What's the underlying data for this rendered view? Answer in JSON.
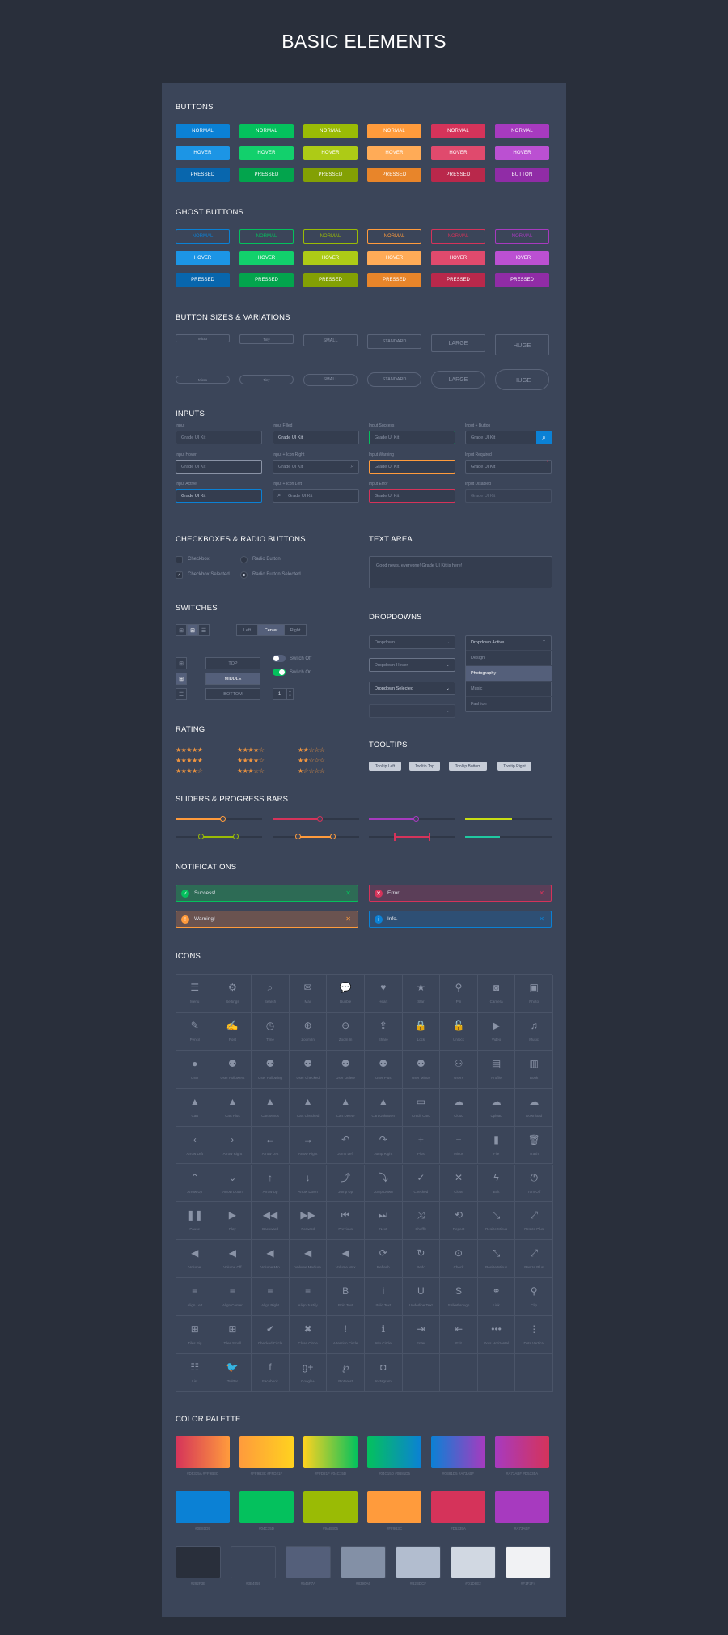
{
  "title": "BASIC ELEMENTS",
  "sections": {
    "buttons": "BUTTONS",
    "ghost": "GHOST BUTTONS",
    "sizes": "BUTTON SIZES & VARIATIONS",
    "inputs": "INPUTS",
    "checkboxes": "CHECKBOXES & RADIO BUTTONS",
    "textarea": "TEXT AREA",
    "switches": "SWITCHES",
    "dropdowns": "DROPDOWNS",
    "rating": "RATING",
    "tooltips": "TOOLTIPS",
    "sliders": "SLIDERS & PROGRESS BARS",
    "notifications": "NOTIFICATIONS",
    "icons": "ICONS",
    "palette": "COLOR PALETTE"
  },
  "colors": [
    "#0b81d5",
    "#04c15d",
    "#9abb05",
    "#ff9b3c",
    "#d5335a",
    "#a73abf"
  ],
  "hover_colors": [
    "#1c95e5",
    "#12d06c",
    "#adcb16",
    "#ffab57",
    "#e04a6d",
    "#bb50d2"
  ],
  "pressed_colors": [
    "#0866ad",
    "#03a44d",
    "#83a004",
    "#e8852a",
    "#b9284b",
    "#902ca6"
  ],
  "buttons": {
    "rows": [
      [
        "NORMAL",
        "NORMAL",
        "NORMAL",
        "NORMAL",
        "NORMAL",
        "NORMAL"
      ],
      [
        "HOVER",
        "HOVER",
        "HOVER",
        "HOVER",
        "HOVER",
        "HOVER"
      ],
      [
        "PRESSED",
        "PRESSED",
        "PRESSED",
        "PRESSED",
        "PRESSED",
        "BUTTON"
      ]
    ]
  },
  "ghost_buttons": {
    "rows": [
      [
        "NORMAL",
        "NORMAL",
        "NORMAL",
        "NORMAL",
        "NORMAL",
        "NORMAL"
      ],
      [
        "HOVER",
        "HOVER",
        "HOVER",
        "HOVER",
        "HOVER",
        "HOVER"
      ],
      [
        "PRESSED",
        "PRESSED",
        "PRESSED",
        "PRESSED",
        "PRESSED",
        "PRESSED"
      ]
    ]
  },
  "sizes": [
    "Micro",
    "Tiny",
    "SMALL",
    "STANDARD",
    "LARGE",
    "HUGE"
  ],
  "inputs": [
    {
      "label": "Input",
      "value": "Grade UI Kit"
    },
    {
      "label": "Input Filled",
      "value": "Grade UI Kit"
    },
    {
      "label": "Input Success",
      "value": "Grade UI Kit"
    },
    {
      "label": "Input + Button",
      "value": "Grade UI Kit"
    },
    {
      "label": "Input Hover",
      "value": "Grade UI Kit"
    },
    {
      "label": "Input + Icon Right",
      "value": "Grade UI Kit"
    },
    {
      "label": "Input Warning",
      "value": "Grade UI Kit"
    },
    {
      "label": "Input Required",
      "value": "Grade UI Kit"
    },
    {
      "label": "Input Active",
      "value": "Grade UI Kit"
    },
    {
      "label": "Input + Icon Left",
      "value": "Grade UI Kit"
    },
    {
      "label": "Input Error",
      "value": "Grade UI Kit"
    },
    {
      "label": "Input Disabled",
      "value": "Grade UI Kit"
    }
  ],
  "checkboxes": {
    "cb1": "Checkbox",
    "cb2": "Checkbox Selected",
    "rb1": "Radio Button",
    "rb2": "Radio Button Selected"
  },
  "textarea": {
    "value": "Good news, everyone! Grade UI Kit is here!"
  },
  "switches": {
    "segments": [
      "Left",
      "Center",
      "Right"
    ],
    "vertical": [
      "TOP",
      "MIDDLE",
      "BOTTOM"
    ],
    "switch_off": "Switch Off",
    "switch_on": "Switch On",
    "stepper": "1"
  },
  "dropdowns": {
    "d1": "Dropdown",
    "d2": "Dropdown Hover",
    "d3": "Dropdown Selected",
    "active": "Dropdown Active",
    "options": [
      "Design",
      "Photography",
      "Music",
      "Fashion"
    ]
  },
  "ratings": [
    [
      "★★★★★",
      "★★★★☆",
      "★★☆☆☆"
    ],
    [
      "★★★★★",
      "★★★★☆",
      "★★☆☆☆"
    ],
    [
      "★★★★☆",
      "★★★☆☆",
      "★☆☆☆☆"
    ]
  ],
  "tooltips": [
    "Tooltip Left",
    "Tooltip Top",
    "Tooltip Bottom",
    "Tooltip Right"
  ],
  "sliders": [
    {
      "fraction": 0.8,
      "color": "#ff9b3c"
    },
    {
      "fraction": 0.8,
      "color": "#d5335a"
    },
    {
      "fraction": 0.8,
      "color": "#a73abf"
    },
    {
      "fraction": 0.8,
      "color": "#c8de14"
    },
    {
      "range": [
        0.4,
        1.2
      ],
      "color": "#9abb05"
    },
    {
      "range": [
        0.4,
        1.2
      ],
      "color": "#ff9b3c"
    },
    {
      "range": [
        0.4,
        1.2
      ],
      "color": "#d5335a"
    },
    {
      "range": [
        0,
        0.8
      ],
      "color": "#1fc9a1"
    }
  ],
  "notifications": [
    {
      "text": "Success!",
      "type": "success"
    },
    {
      "text": "Error!",
      "type": "error"
    },
    {
      "text": "Warning!",
      "type": "warning"
    },
    {
      "text": "Info.",
      "type": "info"
    }
  ],
  "icons": [
    {
      "g": "☰",
      "l": "Menu",
      "n": "menu-icon"
    },
    {
      "g": "⚙",
      "l": "Settings",
      "n": "settings-icon"
    },
    {
      "g": "⌕",
      "l": "Search",
      "n": "search-icon"
    },
    {
      "g": "✉",
      "l": "Mail",
      "n": "mail-icon"
    },
    {
      "g": "💬",
      "l": "Bubble",
      "n": "bubble-icon"
    },
    {
      "g": "♥",
      "l": "Heart",
      "n": "heart-icon"
    },
    {
      "g": "★",
      "l": "Star",
      "n": "star-icon"
    },
    {
      "g": "⚲",
      "l": "Pin",
      "n": "pin-icon"
    },
    {
      "g": "◙",
      "l": "Camera",
      "n": "camera-icon"
    },
    {
      "g": "▣",
      "l": "Photo",
      "n": "photo-icon"
    },
    {
      "g": "✎",
      "l": "Pencil",
      "n": "pencil-icon"
    },
    {
      "g": "✍",
      "l": "Post",
      "n": "post-icon"
    },
    {
      "g": "◷",
      "l": "Time",
      "n": "time-icon"
    },
    {
      "g": "⊕",
      "l": "Zoom In",
      "n": "zoom-in-icon"
    },
    {
      "g": "⊖",
      "l": "Zoom In",
      "n": "zoom-out-icon"
    },
    {
      "g": "⇪",
      "l": "Share",
      "n": "share-icon"
    },
    {
      "g": "🔒",
      "l": "Lock",
      "n": "lock-icon"
    },
    {
      "g": "🔓",
      "l": "Unlock",
      "n": "unlock-icon"
    },
    {
      "g": "▶",
      "l": "Video",
      "n": "video-icon"
    },
    {
      "g": "♫",
      "l": "Music",
      "n": "music-icon"
    },
    {
      "g": "●",
      "l": "User",
      "n": "user-icon"
    },
    {
      "g": "⚉",
      "l": "User Followers",
      "n": "user-followers-icon"
    },
    {
      "g": "⚉",
      "l": "User Following",
      "n": "user-following-icon"
    },
    {
      "g": "⚉",
      "l": "User Checked",
      "n": "user-checked-icon"
    },
    {
      "g": "⚉",
      "l": "User Delete",
      "n": "user-delete-icon"
    },
    {
      "g": "⚉",
      "l": "User Plus",
      "n": "user-plus-icon"
    },
    {
      "g": "⚉",
      "l": "User Minus",
      "n": "user-minus-icon"
    },
    {
      "g": "⚇",
      "l": "Users",
      "n": "users-icon"
    },
    {
      "g": "▤",
      "l": "Profile",
      "n": "profile-icon"
    },
    {
      "g": "▥",
      "l": "Book",
      "n": "book-icon"
    },
    {
      "g": "▲",
      "l": "Cart",
      "n": "cart-icon"
    },
    {
      "g": "▲",
      "l": "Cart Plus",
      "n": "cart-plus-icon"
    },
    {
      "g": "▲",
      "l": "Cart Minus",
      "n": "cart-minus-icon"
    },
    {
      "g": "▲",
      "l": "Cart Checked",
      "n": "cart-checked-icon"
    },
    {
      "g": "▲",
      "l": "Cart Delete",
      "n": "cart-delete-icon"
    },
    {
      "g": "▲",
      "l": "Cart Unknown",
      "n": "cart-unknown-icon"
    },
    {
      "g": "▭",
      "l": "Credit Card",
      "n": "credit-card-icon"
    },
    {
      "g": "☁",
      "l": "Cloud",
      "n": "cloud-icon"
    },
    {
      "g": "☁",
      "l": "Upload",
      "n": "upload-icon"
    },
    {
      "g": "☁",
      "l": "Download",
      "n": "download-icon"
    },
    {
      "g": "‹",
      "l": "Arrow Left",
      "n": "arrow-left-icon"
    },
    {
      "g": "›",
      "l": "Arrow Right",
      "n": "arrow-right-icon"
    },
    {
      "g": "←",
      "l": "Arrow Left",
      "n": "long-arrow-left-icon"
    },
    {
      "g": "→",
      "l": "Arrow Right",
      "n": "long-arrow-right-icon"
    },
    {
      "g": "↶",
      "l": "Jump Left",
      "n": "jump-left-icon"
    },
    {
      "g": "↷",
      "l": "Jump Right",
      "n": "jump-right-icon"
    },
    {
      "g": "+",
      "l": "Plus",
      "n": "plus-icon"
    },
    {
      "g": "−",
      "l": "Minus",
      "n": "minus-icon"
    },
    {
      "g": "▮",
      "l": "File",
      "n": "file-icon"
    },
    {
      "g": "🗑",
      "l": "Trash",
      "n": "trash-icon"
    },
    {
      "g": "⌃",
      "l": "Arrow Up",
      "n": "arrow-up-icon"
    },
    {
      "g": "⌄",
      "l": "Arrow Down",
      "n": "arrow-down-icon"
    },
    {
      "g": "↑",
      "l": "Arrow Up",
      "n": "long-arrow-up-icon"
    },
    {
      "g": "↓",
      "l": "Arrow Down",
      "n": "long-arrow-down-icon"
    },
    {
      "g": "⤴",
      "l": "Jump Up",
      "n": "jump-up-icon"
    },
    {
      "g": "⤵",
      "l": "Jump Down",
      "n": "jump-down-icon"
    },
    {
      "g": "✓",
      "l": "Checked",
      "n": "checked-icon"
    },
    {
      "g": "✕",
      "l": "Close",
      "n": "close-icon"
    },
    {
      "g": "ϟ",
      "l": "Bolt",
      "n": "bolt-icon"
    },
    {
      "g": "⏻",
      "l": "Turn Off",
      "n": "turn-off-icon"
    },
    {
      "g": "❚❚",
      "l": "Pause",
      "n": "pause-icon"
    },
    {
      "g": "▶",
      "l": "Play",
      "n": "play-icon"
    },
    {
      "g": "◀◀",
      "l": "Backward",
      "n": "backward-icon"
    },
    {
      "g": "▶▶",
      "l": "Forward",
      "n": "forward-icon"
    },
    {
      "g": "⏮",
      "l": "Previous",
      "n": "previous-icon"
    },
    {
      "g": "⏭",
      "l": "Next",
      "n": "next-icon"
    },
    {
      "g": "⤨",
      "l": "Shuffle",
      "n": "shuffle-icon"
    },
    {
      "g": "⟲",
      "l": "Repeat",
      "n": "repeat-icon"
    },
    {
      "g": "⤡",
      "l": "Resize Minus",
      "n": "resize-minus-icon"
    },
    {
      "g": "⤢",
      "l": "Resize Plus",
      "n": "resize-plus-icon"
    },
    {
      "g": "◀",
      "l": "Volume",
      "n": "volume-icon"
    },
    {
      "g": "◀",
      "l": "Volume Off",
      "n": "volume-off-icon"
    },
    {
      "g": "◀",
      "l": "Volume Min",
      "n": "volume-min-icon"
    },
    {
      "g": "◀",
      "l": "Volume Medium",
      "n": "volume-medium-icon"
    },
    {
      "g": "◀",
      "l": "Volume Max",
      "n": "volume-max-icon"
    },
    {
      "g": "⟳",
      "l": "Refresh",
      "n": "refresh-icon"
    },
    {
      "g": "↻",
      "l": "Redo",
      "n": "redo-icon"
    },
    {
      "g": "⊙",
      "l": "Check",
      "n": "check-circle-icon"
    },
    {
      "g": "⤡",
      "l": "Resize Minus",
      "n": "resize-minus-2-icon"
    },
    {
      "g": "⤢",
      "l": "Resize Plus",
      "n": "resize-plus-2-icon"
    },
    {
      "g": "≡",
      "l": "Align Left",
      "n": "align-left-icon"
    },
    {
      "g": "≡",
      "l": "Align Center",
      "n": "align-center-icon"
    },
    {
      "g": "≡",
      "l": "Align Right",
      "n": "align-right-icon"
    },
    {
      "g": "≡",
      "l": "Align Justify",
      "n": "align-justify-icon"
    },
    {
      "g": "B",
      "l": "Bold Text",
      "n": "bold-text-icon"
    },
    {
      "g": "i",
      "l": "Italic Text",
      "n": "italic-text-icon"
    },
    {
      "g": "U",
      "l": "Underline Text",
      "n": "underline-text-icon"
    },
    {
      "g": "S",
      "l": "Strikethrough",
      "n": "strikethrough-icon"
    },
    {
      "g": "⚭",
      "l": "Link",
      "n": "link-icon"
    },
    {
      "g": "⚲",
      "l": "Clip",
      "n": "clip-icon"
    },
    {
      "g": "⊞",
      "l": "Tiles Big",
      "n": "tiles-big-icon"
    },
    {
      "g": "⊞",
      "l": "Tiles Small",
      "n": "tiles-small-icon"
    },
    {
      "g": "✔",
      "l": "Checked Circle",
      "n": "checked-circle-icon"
    },
    {
      "g": "✖",
      "l": "Close Circle",
      "n": "close-circle-icon"
    },
    {
      "g": "!",
      "l": "Attention Circle",
      "n": "attention-circle-icon"
    },
    {
      "g": "ℹ",
      "l": "Info Circle",
      "n": "info-circle-icon"
    },
    {
      "g": "⇥",
      "l": "Enter",
      "n": "enter-icon"
    },
    {
      "g": "⇤",
      "l": "Exit",
      "n": "exit-icon"
    },
    {
      "g": "•••",
      "l": "Dots Horizontal",
      "n": "dots-horizontal-icon"
    },
    {
      "g": "⋮",
      "l": "Dots Vertical",
      "n": "dots-vertical-icon"
    },
    {
      "g": "☷",
      "l": "List",
      "n": "list-icon"
    },
    {
      "g": "🐦",
      "l": "Twitter",
      "n": "twitter-icon"
    },
    {
      "g": "f",
      "l": "Facebook",
      "n": "facebook-icon"
    },
    {
      "g": "g+",
      "l": "Google+",
      "n": "google-plus-icon"
    },
    {
      "g": "℘",
      "l": "Pinterest",
      "n": "pinterest-icon"
    },
    {
      "g": "◘",
      "l": "Instagram",
      "n": "instagram-icon"
    }
  ],
  "palette": {
    "gradients": [
      {
        "from": "#d5335a",
        "to": "#ff9b3c",
        "labels": [
          "#D5335A",
          "#FF9B3C"
        ]
      },
      {
        "from": "#ff9b3c",
        "to": "#ffd21f",
        "labels": [
          "#FF9B3C",
          "#FFD21F"
        ]
      },
      {
        "from": "#ffd21f",
        "to": "#04c15d",
        "labels": [
          "#FFD21F",
          "#04C15D"
        ]
      },
      {
        "from": "#04c15d",
        "to": "#0b81d5",
        "labels": [
          "#04C15D",
          "#0B81D5"
        ]
      },
      {
        "from": "#0b81d5",
        "to": "#a73abf",
        "labels": [
          "#0B81D5",
          "#A73ABF"
        ]
      },
      {
        "from": "#a73abf",
        "to": "#d5335a",
        "labels": [
          "#A73ABF",
          "#D5335A"
        ]
      }
    ],
    "solids": [
      {
        "color": "#0b81d5",
        "label": "#0B81D5"
      },
      {
        "color": "#04c15d",
        "label": "#04C15D"
      },
      {
        "color": "#9abb05",
        "label": "#9ABB05"
      },
      {
        "color": "#ff9b3c",
        "label": "#FF9B3C"
      },
      {
        "color": "#d5335a",
        "label": "#D5335A"
      },
      {
        "color": "#a73abf",
        "label": "#A73ABF"
      }
    ],
    "grays": [
      {
        "color": "#292f3b",
        "label": "#292F3B"
      },
      {
        "color": "#3b4559",
        "label": "#3B4559"
      },
      {
        "color": "#545f7a",
        "label": "#545F7A"
      },
      {
        "color": "#8390a6",
        "label": "#8390A6"
      },
      {
        "color": "#b2bdcf",
        "label": "#B2BDCF"
      },
      {
        "color": "#d1d8e2",
        "label": "#D1D8E2"
      },
      {
        "color": "#f1f2f4",
        "label": "#F1F2F4"
      }
    ]
  }
}
